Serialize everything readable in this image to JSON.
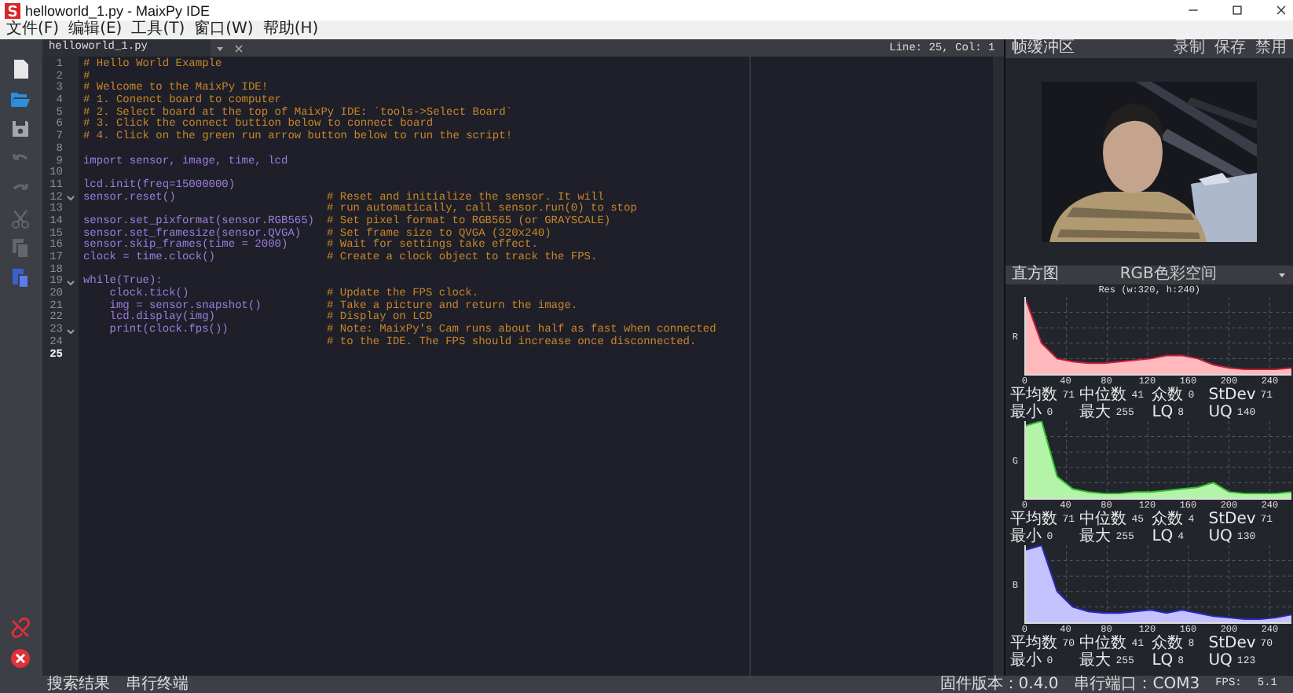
{
  "window": {
    "title": "helloworld_1.py - MaixPy IDE"
  },
  "menu": [
    "文件(F)",
    "编辑(E)",
    "工具(T)",
    "窗口(W)",
    "帮助(H)"
  ],
  "toolbar": [
    {
      "kind": "new",
      "disabled": false
    },
    {
      "kind": "open",
      "disabled": false
    },
    {
      "kind": "save",
      "disabled": false
    },
    {
      "kind": "undo",
      "disabled": true
    },
    {
      "kind": "redo",
      "disabled": true
    },
    {
      "kind": "cut",
      "disabled": true
    },
    {
      "kind": "copy",
      "disabled": true
    },
    {
      "kind": "paste",
      "disabled": false
    }
  ],
  "device_tools": [
    {
      "kind": "connect"
    },
    {
      "kind": "stop"
    }
  ],
  "editor": {
    "tab": "helloworld_1.py",
    "cursor": "Line: 25, Col: 1",
    "lines": [
      {
        "number": "1",
        "kind": "comment",
        "comment": "# Hello World Example",
        "fold": false,
        "current": false
      },
      {
        "number": "2",
        "kind": "comment",
        "comment": "#",
        "fold": false,
        "current": false
      },
      {
        "number": "3",
        "kind": "comment",
        "comment": "# Welcome to the MaixPy IDE!",
        "fold": false,
        "current": false
      },
      {
        "number": "4",
        "kind": "comment",
        "comment": "# 1. Conenct board to computer",
        "fold": false,
        "current": false
      },
      {
        "number": "5",
        "kind": "comment",
        "comment": "# 2. Select board at the top of MaixPy IDE: `tools->Select Board`",
        "fold": false,
        "current": false
      },
      {
        "number": "6",
        "kind": "comment",
        "comment": "# 3. Click the connect buttion below to connect board",
        "fold": false,
        "current": false
      },
      {
        "number": "7",
        "kind": "comment",
        "comment": "# 4. Click on the green run arrow button below to run the script!",
        "fold": false,
        "current": false
      },
      {
        "number": "8",
        "kind": "blank",
        "fold": false,
        "current": false
      },
      {
        "number": "9",
        "kind": "code",
        "code": "import sensor, image, time, lcd",
        "fold": false,
        "current": false
      },
      {
        "number": "10",
        "kind": "blank",
        "fold": false,
        "current": false
      },
      {
        "number": "11",
        "kind": "code",
        "code": "lcd.init(freq=15000000)",
        "fold": false,
        "current": false
      },
      {
        "number": "12",
        "kind": "code",
        "code": "sensor.reset()",
        "comment": "# Reset and initialize the sensor. It will",
        "fold": true,
        "current": false
      },
      {
        "number": "13",
        "kind": "code",
        "comment": "# run automatically, call sensor.run(0) to stop",
        "fold": false,
        "current": false
      },
      {
        "number": "14",
        "kind": "code",
        "code": "sensor.set_pixformat(sensor.RGB565)",
        "comment": "# Set pixel format to RGB565 (or GRAYSCALE)",
        "fold": false,
        "current": false
      },
      {
        "number": "15",
        "kind": "code",
        "code": "sensor.set_framesize(sensor.QVGA)",
        "comment": "# Set frame size to QVGA (320x240)",
        "fold": false,
        "current": false
      },
      {
        "number": "16",
        "kind": "code",
        "code": "sensor.skip_frames(time = 2000)",
        "comment": "# Wait for settings take effect.",
        "fold": false,
        "current": false
      },
      {
        "number": "17",
        "kind": "code",
        "code": "clock = time.clock()",
        "comment": "# Create a clock object to track the FPS.",
        "fold": false,
        "current": false
      },
      {
        "number": "18",
        "kind": "blank",
        "fold": false,
        "current": false
      },
      {
        "number": "19",
        "kind": "code",
        "code": "while(True):",
        "fold": true,
        "current": false
      },
      {
        "number": "20",
        "kind": "code",
        "code": "    clock.tick()",
        "comment": "# Update the FPS clock.",
        "fold": false,
        "current": false
      },
      {
        "number": "21",
        "kind": "code",
        "code": "    img = sensor.snapshot()",
        "comment": "# Take a picture and return the image.",
        "fold": false,
        "current": false
      },
      {
        "number": "22",
        "kind": "code",
        "code": "    lcd.display(img)",
        "comment": "# Display on LCD",
        "fold": false,
        "current": false
      },
      {
        "number": "23",
        "kind": "code",
        "code": "    print(clock.fps())",
        "comment": "# Note: MaixPy's Cam runs about half as fast when connected",
        "fold": true,
        "current": false
      },
      {
        "number": "24",
        "kind": "code",
        "comment": "# to the IDE. The FPS should increase once disconnected.",
        "fold": false,
        "current": false
      },
      {
        "number": "25",
        "kind": "blank",
        "fold": false,
        "current": true
      }
    ]
  },
  "frame_buffer": {
    "title": "帧缓冲区",
    "buttons": [
      "录制",
      "保存",
      "禁用"
    ],
    "kind": "picture"
  },
  "histogram": {
    "title": "直方图",
    "color_space": "RGB色彩空间",
    "resolution": "Res (w:320, h:240)",
    "channels": [
      {
        "label": "R",
        "color": "#ffb8bc",
        "ticks": [
          "0",
          "40",
          "80",
          "120",
          "160",
          "200",
          "240"
        ],
        "stats": [
          {
            "label": "平均数",
            "value": "71"
          },
          {
            "label": "中位数",
            "value": "41"
          },
          {
            "label": "众数",
            "value": "0"
          },
          {
            "label": "StDev",
            "value": "71"
          },
          {
            "label": "最小",
            "value": "0"
          },
          {
            "label": "最大",
            "value": "255"
          },
          {
            "label": "LQ",
            "value": "8"
          },
          {
            "label": "UQ",
            "value": "140"
          }
        ]
      },
      {
        "label": "G",
        "color": "#b4f4a8",
        "ticks": [
          "0",
          "40",
          "80",
          "120",
          "160",
          "200",
          "240"
        ],
        "stats": [
          {
            "label": "平均数",
            "value": "71"
          },
          {
            "label": "中位数",
            "value": "45"
          },
          {
            "label": "众数",
            "value": "4"
          },
          {
            "label": "StDev",
            "value": "71"
          },
          {
            "label": "最小",
            "value": "0"
          },
          {
            "label": "最大",
            "value": "255"
          },
          {
            "label": "LQ",
            "value": "4"
          },
          {
            "label": "UQ",
            "value": "130"
          }
        ]
      },
      {
        "label": "B",
        "color": "#c4c2ff",
        "ticks": [
          "0",
          "40",
          "80",
          "120",
          "160",
          "200",
          "240"
        ],
        "stats": [
          {
            "label": "平均数",
            "value": "70"
          },
          {
            "label": "中位数",
            "value": "41"
          },
          {
            "label": "众数",
            "value": "8"
          },
          {
            "label": "StDev",
            "value": "70"
          },
          {
            "label": "最小",
            "value": "0"
          },
          {
            "label": "最大",
            "value": "255"
          },
          {
            "label": "LQ",
            "value": "8"
          },
          {
            "label": "UQ",
            "value": "123"
          }
        ]
      }
    ]
  },
  "status_bar": {
    "tabs": [
      "搜索结果",
      "串行终端"
    ],
    "firmware": "固件版本：0.4.0",
    "port": "串行端口：COM3",
    "fps_label": "FPS:",
    "fps": "5.1"
  }
}
